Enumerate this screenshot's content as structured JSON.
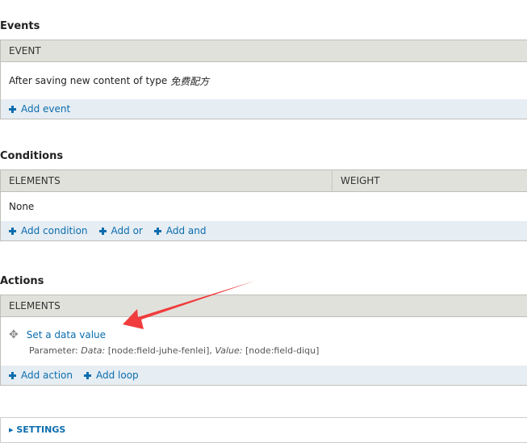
{
  "events": {
    "title": "Events",
    "header": "EVENT",
    "row_text": "After saving new content of type",
    "row_type": "免费配方",
    "add_event": "Add event"
  },
  "conditions": {
    "title": "Conditions",
    "headers": [
      "ELEMENTS",
      "WEIGHT"
    ],
    "row_text": "None",
    "links": [
      "Add condition",
      "Add or",
      "Add and"
    ]
  },
  "actions": {
    "title": "Actions",
    "header": "ELEMENTS",
    "item_label": "Set a data value",
    "param_prefix": "Parameter:",
    "param_data_label": "Data:",
    "param_data_value": "[node:field-juhe-fenlei],",
    "param_value_label": "Value:",
    "param_value_value": "[node:field-diqu]",
    "links": [
      "Add action",
      "Add loop"
    ]
  },
  "settings": {
    "label": "SETTINGS"
  },
  "annotation": {
    "color": "#f03c3c"
  }
}
